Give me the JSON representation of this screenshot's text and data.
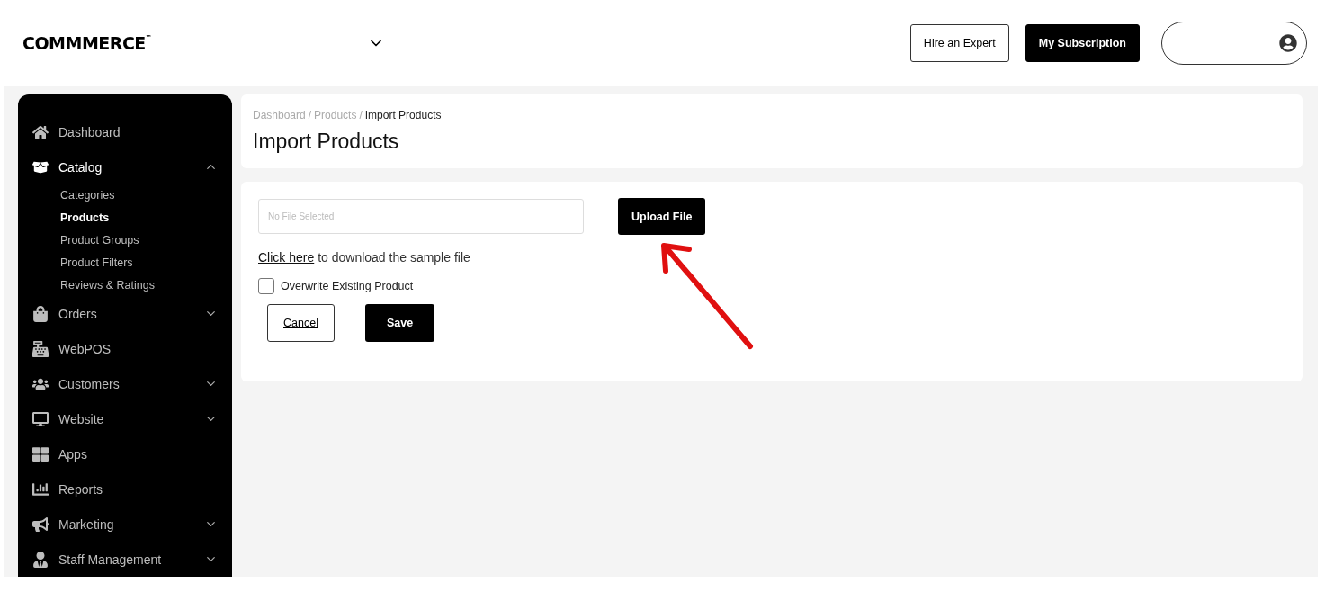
{
  "header": {
    "logo": "COMMMERCE",
    "logo_mark": "™",
    "buttons": [
      {
        "label": "Hire an Expert",
        "kind": "outline"
      },
      {
        "label": "My Subscription",
        "kind": "solid"
      }
    ]
  },
  "sidebar": {
    "items": [
      {
        "label": "Dashboard",
        "kind": "link",
        "selected": false
      },
      {
        "label": "Catalog",
        "kind": "group",
        "selected": true,
        "expanded": true,
        "children": [
          {
            "label": "Categories",
            "selected": false
          },
          {
            "label": "Products",
            "selected": true
          },
          {
            "label": "Product Groups",
            "selected": false
          },
          {
            "label": "Product Filters",
            "selected": false
          },
          {
            "label": "Reviews & Ratings",
            "selected": false
          }
        ]
      },
      {
        "label": "Orders",
        "kind": "group",
        "selected": false,
        "expanded": false
      },
      {
        "label": "WebPOS",
        "kind": "link",
        "selected": false
      },
      {
        "label": "Customers",
        "kind": "group",
        "selected": false,
        "expanded": false
      },
      {
        "label": "Website",
        "kind": "group",
        "selected": false,
        "expanded": false
      },
      {
        "label": "Apps",
        "kind": "link",
        "selected": false
      },
      {
        "label": "Reports",
        "kind": "link",
        "selected": false
      },
      {
        "label": "Marketing",
        "kind": "group",
        "selected": false,
        "expanded": false
      },
      {
        "label": "Staff Management",
        "kind": "group",
        "selected": false,
        "expanded": false
      }
    ]
  },
  "breadcrumb": [
    {
      "label": "Dashboard",
      "selected": false
    },
    {
      "label": "Products",
      "selected": false
    },
    {
      "label": "Import Products",
      "selected": true
    }
  ],
  "breadcrumb_separator": "/",
  "page_title": "Import Products",
  "form": {
    "file_field": {
      "placeholder": "No File Selected"
    },
    "upload_button": "Upload File",
    "sample_link": "Click here",
    "sample_text": "to download the sample file",
    "overwrite": {
      "label": "Overwrite Existing Product",
      "checked": false
    },
    "buttons": [
      {
        "label": "Cancel",
        "kind": "outline"
      },
      {
        "label": "Save",
        "kind": "solid"
      }
    ]
  }
}
